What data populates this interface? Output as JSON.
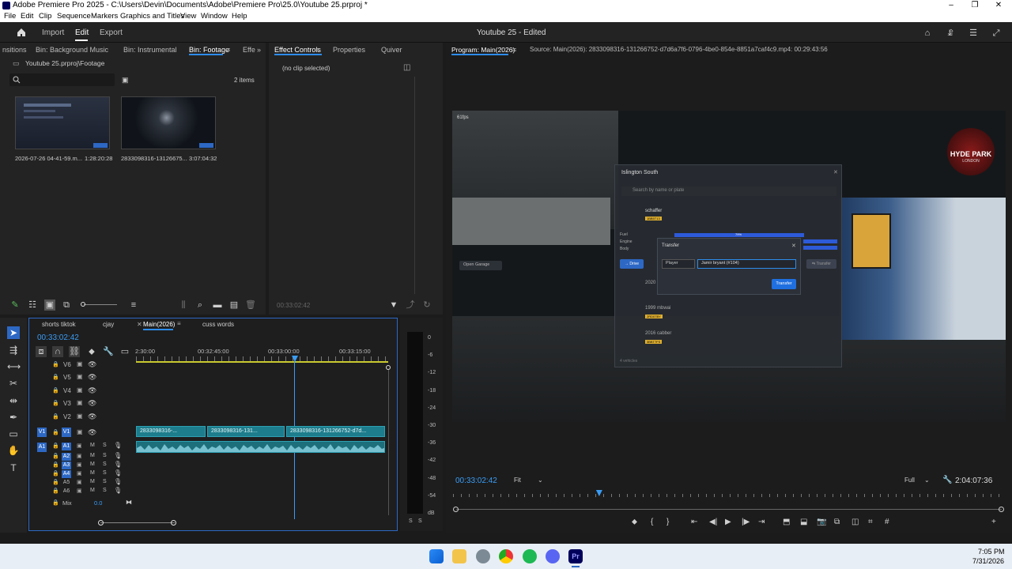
{
  "window": {
    "title": "Adobe Premiere Pro 2025 - C:\\Users\\Devin\\Documents\\Adobe\\Premiere Pro\\25.0\\Youtube 25.prproj *",
    "minimize": "–",
    "maximize": "❐",
    "close": "✕"
  },
  "menu": [
    "File",
    "Edit",
    "Clip",
    "Sequence",
    "Markers",
    "Graphics and Titles",
    "View",
    "Window",
    "Help"
  ],
  "header": {
    "import": "Import",
    "edit": "Edit",
    "export": "Export",
    "project_title": "Youtube 25 - Edited"
  },
  "project_panel": {
    "tabs": [
      "nsitions",
      "Bin: Background Music",
      "Bin: Instrumental",
      "Bin: Footage",
      "Effe"
    ],
    "path": "Youtube 25.prproj\\Footage",
    "items_count": "2 items",
    "items": [
      {
        "name": "2026-07-26 04-41-59.m...",
        "duration": "1:28:20:28"
      },
      {
        "name": "2833098316-13126675...",
        "duration": "3:07:04:32"
      }
    ]
  },
  "effect_controls": {
    "tabs": [
      "Effect Controls",
      "Properties",
      "Quiver"
    ],
    "empty": "(no clip selected)",
    "timecode": "00:33:02:42"
  },
  "program_monitor": {
    "tab": "Program: Main(2026)",
    "source": "Source: Main(2026): 2833098316-131266752-d7d6a7f6-0796-4be0-854e-8851a7caf4c9.mp4: 00:29:43:56",
    "timecode": "00:33:02:42",
    "fit": "Fit",
    "quality": "Full",
    "duration": "2:04:07:36",
    "playhead_fraction": 0.266,
    "game": {
      "fps": "61fps",
      "garage_title": "Islington South",
      "search_placeholder": "Search by name or plate",
      "owner": "schaffer",
      "plate1": "1BB5T13",
      "stat_labels": [
        "Fuel",
        "Engine",
        "Body"
      ],
      "fuel_pct": "79%",
      "drive": "→ Drive",
      "open_garage": "Open Garage",
      "year2020": "2020",
      "car2": "1999 mbwai",
      "plate2": "2RD07BY",
      "car3": "2016 cabber",
      "plate3": "3BBT7FS",
      "transfer_dialog_title": "Transfer",
      "player_select": "Player",
      "target_select": "Jamir bryant (#104)",
      "transfer_btn": "Transfer",
      "transfer_side": "⇆ Transfer",
      "vehicles_count": "4 vehicles",
      "logo_top": "HYDE PARK",
      "logo_bot": "LONDON"
    }
  },
  "timeline": {
    "tabs": [
      "shorts tiktok",
      "cjay",
      "Main(2026)",
      "cuss words"
    ],
    "timecode": "00:33:02:42",
    "ruler": [
      "2:30:00",
      "00:32:45:00",
      "00:33:00:00",
      "00:33:15:00"
    ],
    "video_tracks": [
      "V6",
      "V5",
      "V4",
      "V3",
      "V2",
      "V1"
    ],
    "audio_tracks": [
      "A1",
      "A2",
      "A3",
      "A4",
      "A5",
      "A6"
    ],
    "mix_label": "Mix",
    "mix_value": "0.0",
    "clips": [
      "2833098316-...",
      "2833098316-131...",
      "2833098316-131266752-d7d..."
    ]
  },
  "audio_meter": {
    "labels": [
      "0",
      "-6",
      "-12",
      "-18",
      "-24",
      "-30",
      "-36",
      "-42",
      "-48",
      "-54",
      "dB"
    ],
    "bottom": [
      "S",
      "S"
    ]
  },
  "taskbar": {
    "time": "7:05 PM",
    "date": "7/31/2026"
  },
  "colors": {
    "accent": "#2d8ceb",
    "clip": "#1d7d8c",
    "bg": "#1b1b1b"
  }
}
